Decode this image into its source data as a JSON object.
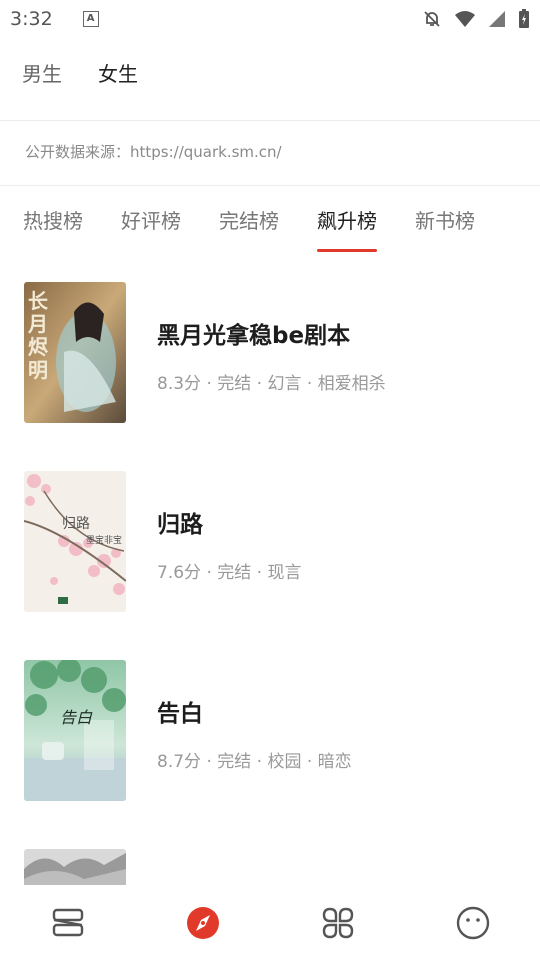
{
  "status": {
    "time": "3:32",
    "a_badge": "A"
  },
  "gender_tabs": [
    {
      "label": "男生",
      "active": false
    },
    {
      "label": "女生",
      "active": true
    }
  ],
  "source_text": "公开数据来源：https://quark.sm.cn/",
  "rank_tabs": [
    {
      "label": "热搜榜",
      "active": false
    },
    {
      "label": "好评榜",
      "active": false
    },
    {
      "label": "完结榜",
      "active": false
    },
    {
      "label": "飙升榜",
      "active": true
    },
    {
      "label": "新书榜",
      "active": false
    }
  ],
  "books": [
    {
      "title": "黑月光拿稳be剧本",
      "meta": "8.3分 · 完结 · 幻言 · 相爱相杀",
      "cover_text": "长月烬明"
    },
    {
      "title": "归路",
      "meta": "7.6分 · 完结 · 现言",
      "cover_text": "归路",
      "cover_author": "墨宝非宝"
    },
    {
      "title": "告白",
      "meta": "8.7分 · 完结 · 校园 · 暗恋",
      "cover_text": "告白"
    },
    {
      "title": "",
      "meta": ""
    }
  ],
  "bottom_nav": [
    {
      "icon": "bookshelf-icon"
    },
    {
      "icon": "compass-icon",
      "active_color": "#e13a2a"
    },
    {
      "icon": "categories-icon"
    },
    {
      "icon": "profile-icon"
    }
  ]
}
